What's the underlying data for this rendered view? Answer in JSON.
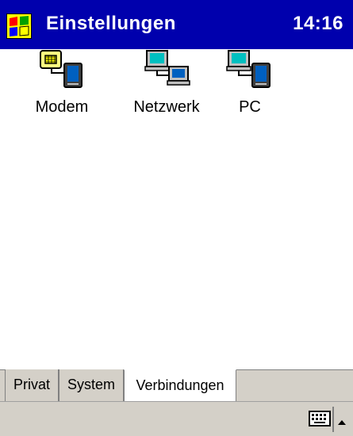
{
  "titlebar": {
    "title": "Einstellungen",
    "time": "14:16",
    "start_icon": "windows-flag-icon"
  },
  "content": {
    "items": [
      {
        "label": "Modem",
        "icon": "modem-icon"
      },
      {
        "label": "Netzwerk",
        "icon": "network-icon"
      },
      {
        "label": "PC",
        "icon": "pc-connection-icon"
      }
    ]
  },
  "tabs": [
    {
      "label": "Privat",
      "active": false
    },
    {
      "label": "System",
      "active": false
    },
    {
      "label": "Verbindungen",
      "active": true
    }
  ],
  "bottombar": {
    "keyboard_icon": "keyboard-icon",
    "arrow_icon": "up-arrow-icon"
  },
  "colors": {
    "titlebar": "#0000ad",
    "chrome": "#d4d0c8",
    "content_bg": "#ffffff"
  }
}
